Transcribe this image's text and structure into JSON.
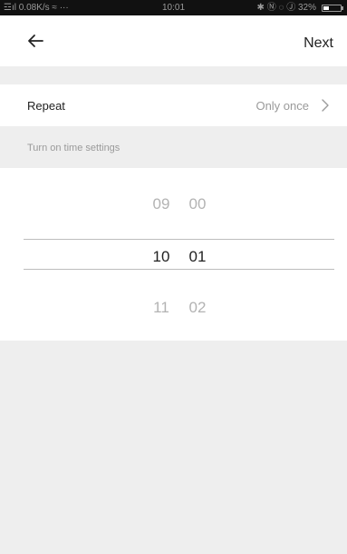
{
  "status_bar": {
    "left": "☲ıl 0.08K/s ≈ ···",
    "time": "10:01",
    "right": "✱ Ⓝ ◌ Ⓙ 32%",
    "battery_level": 0.32
  },
  "nav": {
    "back_icon": "arrow-left-icon",
    "next_label": "Next"
  },
  "repeat": {
    "label": "Repeat",
    "value": "Only once",
    "chevron_icon": "chevron-right-icon"
  },
  "section": {
    "title": "Turn on time settings"
  },
  "picker": {
    "rows": [
      {
        "hour": "09",
        "minute": "00"
      },
      {
        "hour": "10",
        "minute": "01"
      },
      {
        "hour": "11",
        "minute": "02"
      }
    ],
    "selected_index": 1
  },
  "colors": {
    "status_bar_bg": "#111111",
    "band_gray": "#eeeeee",
    "text_primary": "#222222",
    "text_secondary": "#9a9a9a",
    "picker_faded": "#b3b3b3"
  }
}
